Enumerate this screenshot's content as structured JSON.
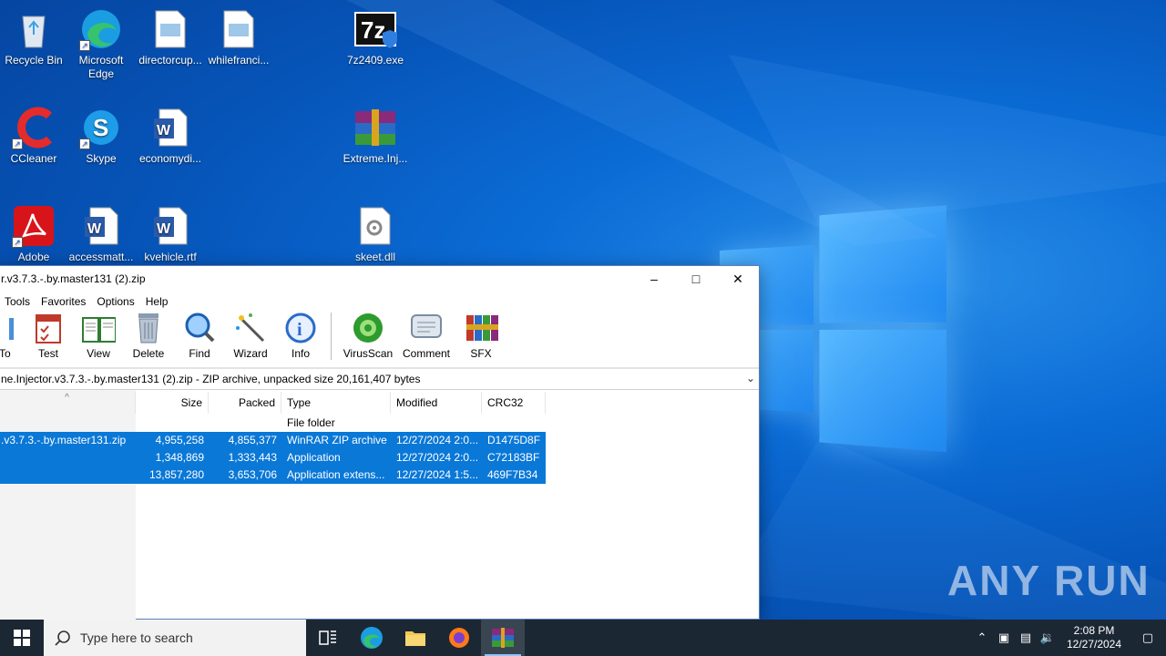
{
  "desktop": {
    "icons": [
      {
        "label": "Recycle Bin",
        "icon": "recycle-bin-icon"
      },
      {
        "label": "Microsoft Edge",
        "icon": "edge-icon"
      },
      {
        "label": "directorcup...",
        "icon": "image-file-icon"
      },
      {
        "label": "whilefranci...",
        "icon": "image-file-icon"
      },
      {
        "label": "7z2409.exe",
        "icon": "7zip-installer-icon"
      },
      {
        "label": "CCleaner",
        "icon": "ccleaner-icon"
      },
      {
        "label": "Skype",
        "icon": "skype-icon"
      },
      {
        "label": "economydi...",
        "icon": "word-doc-icon"
      },
      {
        "label": "Extreme.Inj...",
        "icon": "winrar-archive-icon"
      },
      {
        "label": "Adobe",
        "icon": "adobe-acrobat-icon"
      },
      {
        "label": "accessmatt...",
        "icon": "word-doc-icon"
      },
      {
        "label": "kvehicle.rtf",
        "icon": "word-doc-icon"
      },
      {
        "label": "skeet.dll",
        "icon": "dll-file-icon"
      }
    ]
  },
  "window": {
    "title": "r.v3.7.3.-.by.master131 (2).zip",
    "menu": [
      "Tools",
      "Favorites",
      "Options",
      "Help"
    ],
    "toolbar": [
      {
        "label": "To",
        "icon": "extract-to-icon"
      },
      {
        "label": "Test",
        "icon": "test-icon"
      },
      {
        "label": "View",
        "icon": "view-book-icon"
      },
      {
        "label": "Delete",
        "icon": "trash-icon"
      },
      {
        "label": "Find",
        "icon": "magnifier-icon"
      },
      {
        "label": "Wizard",
        "icon": "wand-icon"
      },
      {
        "label": "Info",
        "icon": "info-icon"
      },
      {
        "label": "VirusScan",
        "icon": "virus-scan-icon"
      },
      {
        "label": "Comment",
        "icon": "comment-icon"
      },
      {
        "label": "SFX",
        "icon": "sfx-icon"
      }
    ],
    "address": "ne.Injector.v3.7.3.-.by.master131 (2).zip - ZIP archive, unpacked size 20,161,407 bytes",
    "columns": {
      "size": "Size",
      "packed": "Packed",
      "type": "Type",
      "modified": "Modified",
      "crc": "CRC32"
    },
    "rows": [
      {
        "name": "",
        "size": "",
        "packed": "",
        "type": "File folder",
        "modified": "",
        "crc": "",
        "selected": false
      },
      {
        "name": ".v3.7.3.-.by.master131.zip",
        "size": "4,955,258",
        "packed": "4,855,377",
        "type": "WinRAR ZIP archive",
        "modified": "12/27/2024 2:0...",
        "crc": "D1475D8F",
        "selected": true
      },
      {
        "name": "",
        "size": "1,348,869",
        "packed": "1,333,443",
        "type": "Application",
        "modified": "12/27/2024 2:0...",
        "crc": "C72183BF",
        "selected": true
      },
      {
        "name": "",
        "size": "13,857,280",
        "packed": "3,653,706",
        "type": "Application extens...",
        "modified": "12/27/2024 1:5...",
        "crc": "469F7B34",
        "selected": true
      }
    ]
  },
  "taskbar": {
    "search_placeholder": "Type here to search",
    "time": "2:08 PM",
    "date": "12/27/2024"
  },
  "watermark": "ANY RUN"
}
